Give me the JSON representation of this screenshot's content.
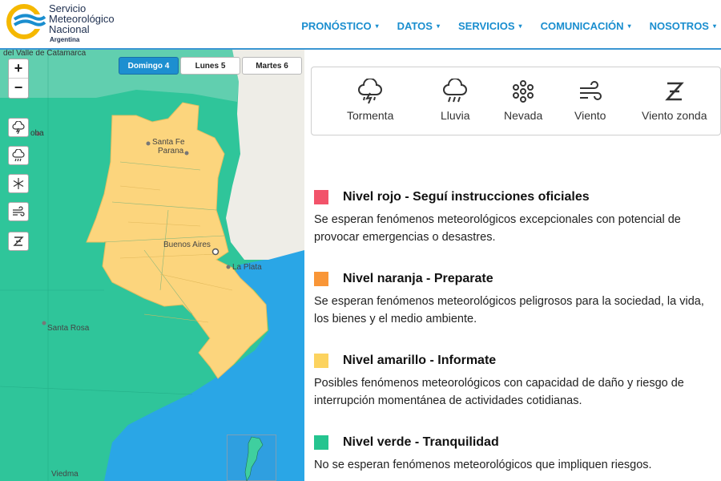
{
  "brand": {
    "line1": "Servicio",
    "line2": "Meteorológico",
    "line3": "Nacional",
    "line4": "Argentina",
    "colors": {
      "navy": "#1e2f4f",
      "accent": "#1a8ecf",
      "logo_yellow": "#f5b800"
    }
  },
  "nav": {
    "items": [
      {
        "label": "PRONÓSTICO"
      },
      {
        "label": "DATOS"
      },
      {
        "label": "SERVICIOS"
      },
      {
        "label": "COMUNICACIÓN"
      },
      {
        "label": "NOSOTROS"
      }
    ],
    "caret": "▾"
  },
  "map": {
    "zoom_in": "+",
    "zoom_out": "−",
    "day_tabs": [
      {
        "label": "Domingo 4",
        "active": true
      },
      {
        "label": "Lunes 5",
        "active": false
      },
      {
        "label": "Martes 6",
        "active": false
      }
    ],
    "layer_icons": [
      "thunderstorm-icon",
      "rain-icon",
      "snow-icon",
      "wind-icon",
      "zonda-wind-icon"
    ],
    "labels": {
      "top_region": "del Valle de Catamarca",
      "cordoba": "oba",
      "santa_fe": "Santa Fe",
      "parana": "Parana",
      "buenos_aires": "Buenos Aires",
      "la_plata": "La Plata",
      "santa_rosa": "Santa Rosa",
      "viedma": "Viedma"
    },
    "colors": {
      "green": "#2fc59a",
      "yellow": "#fcd57d",
      "sea": "#2aa6e6",
      "uruguay": "#eeede7"
    }
  },
  "phenomena": [
    {
      "label": "Tormenta",
      "icon": "thunderstorm-icon"
    },
    {
      "label": "Lluvia",
      "icon": "rain-icon"
    },
    {
      "label": "Nevada",
      "icon": "snow-icon"
    },
    {
      "label": "Viento",
      "icon": "wind-icon"
    },
    {
      "label": "Viento zonda",
      "icon": "zonda-wind-icon"
    }
  ],
  "levels": [
    {
      "color": "#f2536a",
      "title": "Nivel rojo - Seguí instrucciones oficiales",
      "desc": "Se esperan fenómenos meteorológicos excepcionales con potencial de provocar emergencias o desastres."
    },
    {
      "color": "#f99637",
      "title": "Nivel naranja - Preparate",
      "desc": "Se esperan fenómenos meteorológicos peligrosos para la sociedad, la vida, los bienes y el medio ambiente."
    },
    {
      "color": "#fcd35f",
      "title": "Nivel amarillo - Informate",
      "desc": "Posibles fenómenos meteorológicos con capacidad de daño y riesgo de interrupción momentánea de actividades cotidianas."
    },
    {
      "color": "#25c48f",
      "title": "Nivel verde - Tranquilidad",
      "desc": "No se esperan fenómenos meteorológicos que impliquen riesgos."
    }
  ]
}
